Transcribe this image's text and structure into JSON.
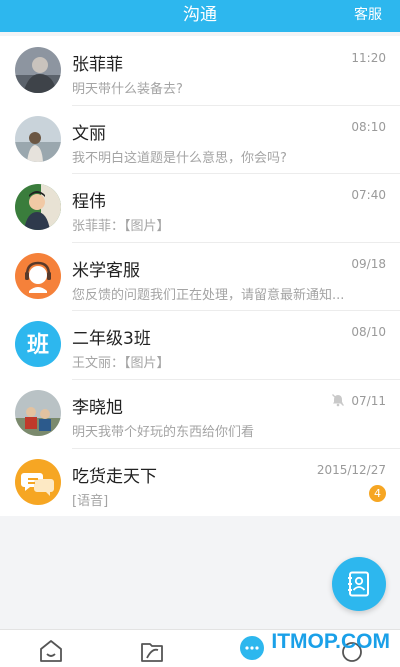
{
  "header": {
    "title": "沟通",
    "service_label": "客服"
  },
  "conversations": [
    {
      "name": "张菲菲",
      "preview": "明天带什么装备去?",
      "time": "11:20",
      "avatar": "photo-woman-icon"
    },
    {
      "name": "文丽",
      "preview": "我不明白这道题是什么意思，你会吗?",
      "time": "08:10",
      "avatar": "photo-woman-field-icon"
    },
    {
      "name": "程伟",
      "preview": "张菲菲：【图片】",
      "time": "07:40",
      "avatar": "photo-boy-icon"
    },
    {
      "name": "米学客服",
      "preview": "您反馈的问题我们正在处理，请留意最新通知...",
      "time": "09/18",
      "avatar": "customer-service-icon"
    },
    {
      "name": "二年级3班",
      "preview": "王文丽：【图片】",
      "time": "08/10",
      "avatar": "class-icon",
      "avatar_text": "班"
    },
    {
      "name": "李晓旭",
      "preview": "明天我带个好玩的东西给你们看",
      "time": "07/11",
      "avatar": "photo-group-icon",
      "muted": true
    },
    {
      "name": "吃货走天下",
      "preview": "[语音]",
      "time": "2015/12/27",
      "avatar": "group-chat-icon",
      "badge": "4"
    }
  ],
  "tabs": [
    "home-icon",
    "book-icon",
    "chat-icon",
    "profile-icon"
  ],
  "watermark": "ITMOP.COM",
  "colors": {
    "primary": "#2db7ee",
    "orange": "#f6a623"
  }
}
